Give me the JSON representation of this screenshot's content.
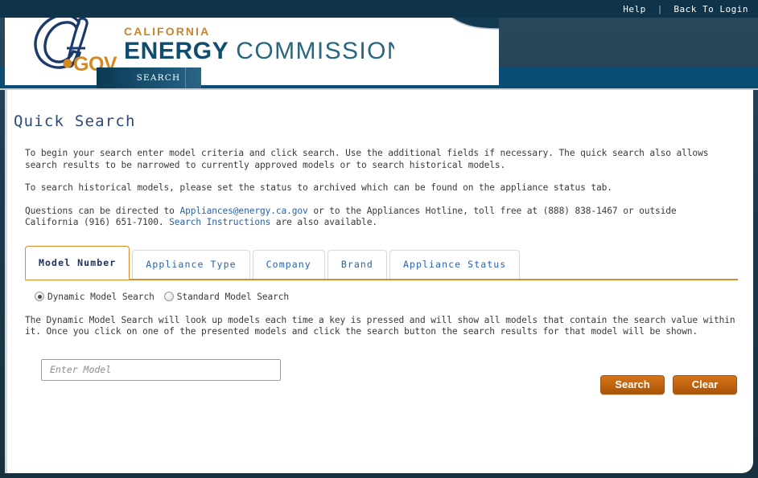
{
  "utility": {
    "help_label": "Help",
    "separator": "|",
    "back_label": "Back To Login"
  },
  "brand": {
    "logo_ca": "CA",
    "logo_gov": ".GOV",
    "line1": "CALIFORNIA",
    "line2_bold": "ENERGY",
    "line2_light": "COMMISSION",
    "accent_orange": "#c8842a",
    "accent_navy": "#0e4d6e"
  },
  "nav": {
    "tabs": [
      {
        "label": "SEARCH",
        "active": true
      }
    ]
  },
  "main": {
    "title": "Quick Search",
    "intro": {
      "p1": "To begin your search enter model criteria and click search. Use the additional fields if necessary. The quick search also allows search results to be narrowed to currently approved models or to search historical models.",
      "p2": "To search historical models, please set the status to archived which can be found on the appliance status tab.",
      "p3_before": "Questions can be directed to ",
      "p3_email": "Appliances@energy.ca.gov",
      "p3_middle": " or to the Appliances Hotline, toll free at (888) 838-1467 or outside California (916) 651-7100. ",
      "p3_link": "Search Instructions",
      "p3_after": " are also available."
    },
    "tabs": [
      {
        "label": "Model Number",
        "active": true
      },
      {
        "label": "Appliance Type",
        "active": false
      },
      {
        "label": "Company",
        "active": false
      },
      {
        "label": "Brand",
        "active": false
      },
      {
        "label": "Appliance Status",
        "active": false
      }
    ],
    "search_mode": {
      "options": [
        {
          "label": "Dynamic Model Search",
          "checked": true
        },
        {
          "label": "Standard Model Search",
          "checked": false
        }
      ]
    },
    "dynamic_description": "The Dynamic Model Search will look up models each time a key is pressed and will show all models that contain the search value within it. Once you click on one of the presented models and click the search button the search results for that model will be shown.",
    "model_input": {
      "value": "",
      "placeholder": "Enter Model"
    },
    "buttons": {
      "search_label": "Search",
      "clear_label": "Clear",
      "accent": "#c3660f"
    }
  }
}
